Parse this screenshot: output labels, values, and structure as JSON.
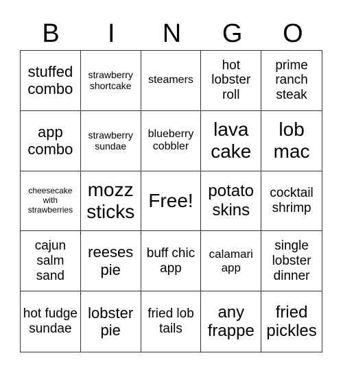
{
  "header": [
    "B",
    "I",
    "N",
    "G",
    "O"
  ],
  "cells": [
    {
      "text": "stuffed combo",
      "size": 22
    },
    {
      "text": "strawberry shortcake",
      "size": 14
    },
    {
      "text": "steamers",
      "size": 16
    },
    {
      "text": "hot lobster roll",
      "size": 19
    },
    {
      "text": "prime ranch steak",
      "size": 19
    },
    {
      "text": "app combo",
      "size": 22
    },
    {
      "text": "strawberry sundae",
      "size": 14
    },
    {
      "text": "blueberry cobbler",
      "size": 16
    },
    {
      "text": "lava cake",
      "size": 28
    },
    {
      "text": "lob mac",
      "size": 28
    },
    {
      "text": "cheesecake with strawberries",
      "size": 12
    },
    {
      "text": "mozz sticks",
      "size": 28
    },
    {
      "text": "Free!",
      "size": 28
    },
    {
      "text": "potato skins",
      "size": 24
    },
    {
      "text": "cocktail shrimp",
      "size": 19
    },
    {
      "text": "cajun salm sand",
      "size": 19
    },
    {
      "text": "reeses pie",
      "size": 22
    },
    {
      "text": "buff chic app",
      "size": 19
    },
    {
      "text": "calamari app",
      "size": 17
    },
    {
      "text": "single lobster dinner",
      "size": 19
    },
    {
      "text": "hot fudge sundae",
      "size": 19
    },
    {
      "text": "lobster pie",
      "size": 22
    },
    {
      "text": "fried lob tails",
      "size": 19
    },
    {
      "text": "any frappe",
      "size": 24
    },
    {
      "text": "fried pickles",
      "size": 24
    }
  ]
}
